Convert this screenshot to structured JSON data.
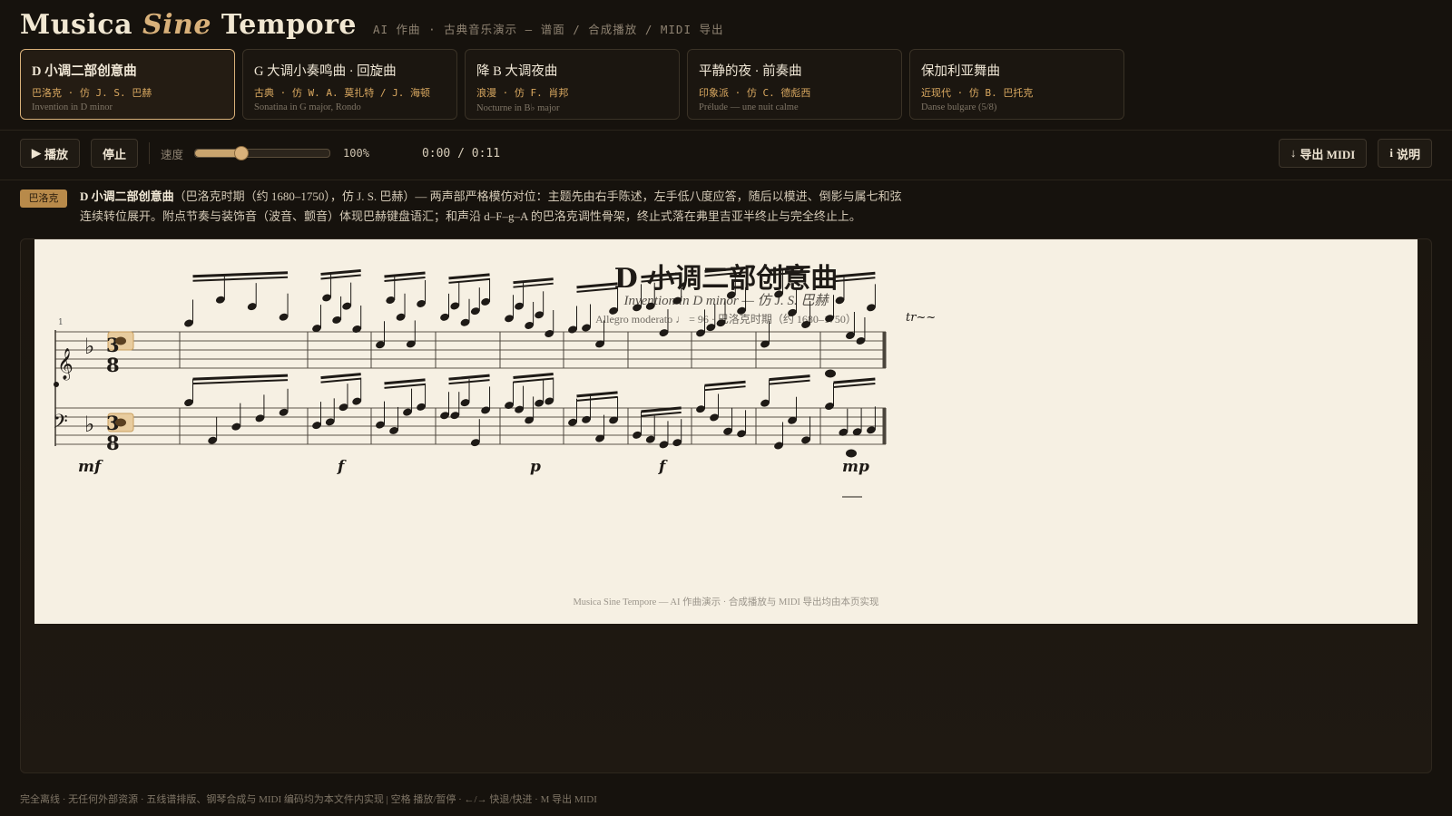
{
  "header": {
    "brand_part1": "Musica ",
    "brand_accent": "Sine",
    "brand_part2": " Tempore",
    "subtitle": "AI 作曲 · 古典音乐演示 — 谱面 / 合成播放 / MIDI 导出"
  },
  "tabs": [
    {
      "title": "D 小调二部创意曲",
      "period": "巴洛克 · 仿 J. S. 巴赫",
      "en": "Invention in D minor",
      "active": true
    },
    {
      "title": "G 大调小奏鸣曲 · 回旋曲",
      "period": "古典 · 仿 W. A. 莫扎特 / J. 海顿",
      "en": "Sonatina in G major, Rondo",
      "active": false
    },
    {
      "title": "降 B 大调夜曲",
      "period": "浪漫 · 仿 F. 肖邦",
      "en": "Nocturne in B♭ major",
      "active": false
    },
    {
      "title": "平静的夜 · 前奏曲",
      "period": "印象派 · 仿 C. 德彪西",
      "en": "Prélude — une nuit calme",
      "active": false
    },
    {
      "title": "保加利亚舞曲",
      "period": "近现代 · 仿 B. 巴托克",
      "en": "Danse bulgare (5/8)",
      "active": false
    }
  ],
  "controls": {
    "play_label": "播放",
    "play_icon": "▶",
    "stop_label": "停止",
    "speed_label": "速度",
    "speed_fraction": 0.34,
    "speed_value": "100%",
    "time": "0:00 / 0:11",
    "export_icon": "↓",
    "export_label": "导出 MIDI",
    "help_icon": "i",
    "help_label": "说明"
  },
  "info": {
    "badge": "巴洛克",
    "title": "D 小调二部创意曲",
    "description": "（巴洛克时期（约 1680–1750），仿 J. S. 巴赫）— 两声部严格模仿对位：主题先由右手陈述，左手低八度应答，随后以模进、倒影与属七和弦连续转位展开。附点节奏与装饰音（波音、颤音）体现巴赫键盘语汇；和声沿 d–F–g–A 的巴洛克调性骨架，终止式落在弗里吉亚半终止与完全终止上。"
  },
  "score": {
    "title": "D 小调二部创意曲",
    "subtitle": "Invention in D minor — 仿 J. S. 巴赫",
    "tempo": "Allegro moderato ♩ = 96 · 巴洛克时期（约 1680–1750）",
    "measure_number": "1",
    "dynamics": [
      "mf",
      "f",
      "p",
      "f",
      "mp"
    ],
    "trill": "tr~~",
    "time_signature": [
      "3",
      "8"
    ],
    "footnote": "Musica Sine Tempore — AI 作曲演示 · 合成播放与 MIDI 导出均由本页实现"
  },
  "footer": {
    "text": "完全离线 · 无任何外部资源 · 五线谱排版、钢琴合成与 MIDI 编码均为本文件内实现 | 空格 播放/暂停 · ←/→ 快退/快进 · M 导出 MIDI"
  },
  "colors": {
    "accent": "#d9b17a",
    "background": "#16120d",
    "paper": "#f6f0e3",
    "ink": "#1e1a16"
  }
}
